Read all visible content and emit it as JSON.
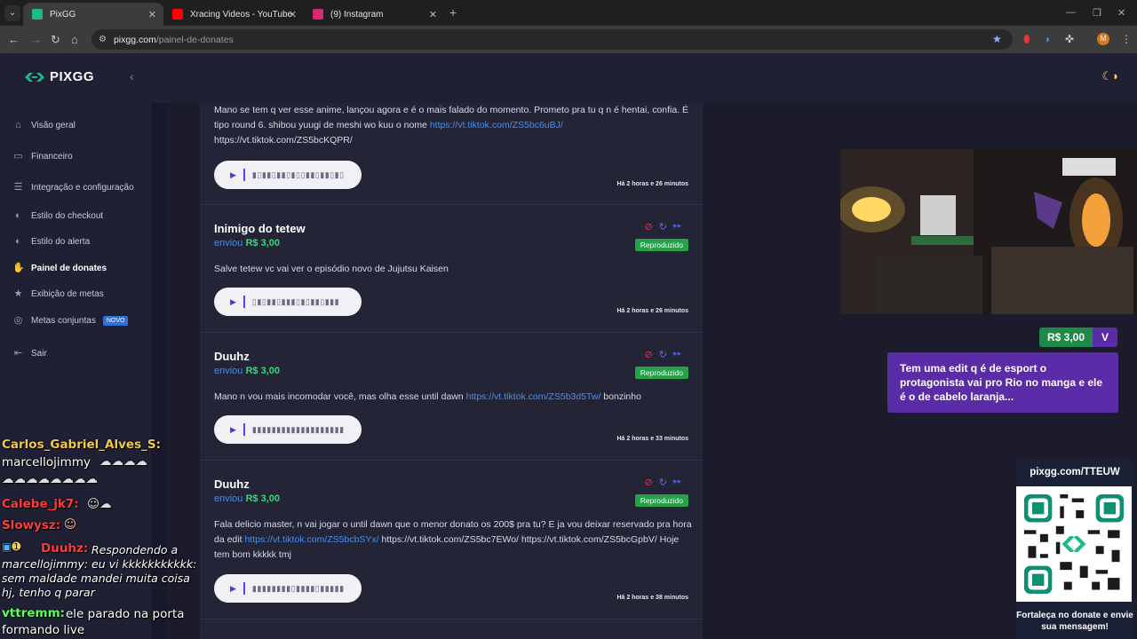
{
  "browser": {
    "tabs": [
      {
        "title": "PixGG",
        "active": true
      },
      {
        "title": "Xracing Videos - YouTube",
        "active": false
      },
      {
        "title": "(9) Instagram",
        "active": false
      }
    ],
    "new_tab": "+",
    "url_host": "pixgg.com",
    "url_path": "/painel-de-donates",
    "profile_initial": "M"
  },
  "sidebar": {
    "brand": "PIXGG",
    "items": [
      {
        "label": "Visão geral",
        "icon": "home-icon"
      },
      {
        "label": "Financeiro",
        "icon": "wallet-icon"
      },
      {
        "label": "Integração e configuração",
        "icon": "settings-icon"
      },
      {
        "label": "Estilo do checkout",
        "icon": "palette-icon"
      },
      {
        "label": "Estilo do alerta",
        "icon": "palette-icon"
      },
      {
        "label": "Painel de donates",
        "icon": "hand-coin-icon"
      },
      {
        "label": "Exibição de metas",
        "icon": "star-icon"
      },
      {
        "label": "Metas conjuntas",
        "icon": "target-icon",
        "badge": "NOVO"
      },
      {
        "label": "Sair",
        "icon": "logout-icon"
      }
    ]
  },
  "feed": {
    "sent_prefix": "enviou",
    "cards": [
      {
        "name": "",
        "amount": "",
        "message_parts": [
          {
            "text": "Mano se tem q ver esse anime, lançou agora e é o mais falado do momento. Prometo pra tu q n é hentai, confia. É tipo round 6. shibou yuugi de meshi wo kuu o nome "
          },
          {
            "text": "https://vt.tiktok.com/ZS5bc6uBJ/",
            "link": true
          },
          {
            "text": " https://vt.tiktok.com/ZS5bcKQPR/"
          }
        ],
        "waveform": "▮▯▮▮▯▮▮▯▮▯▯▮▮▯▮▮▯▮▯",
        "time": "Há 2 horas e 26 minutos"
      },
      {
        "name": "Inimigo do tetew",
        "amount": "R$ 3,00",
        "status": "Reproduzido",
        "message_parts": [
          {
            "text": "Salve tetew vc vai ver o episódio novo de Jujutsu Kaisen"
          }
        ],
        "waveform": "▯▮▯▮▮▯▮▮▮▯▮▯▮▮▯▮▮▮",
        "time": "Há 2 horas e 26 minutos"
      },
      {
        "name": "Duuhz",
        "amount": "R$ 3,00",
        "status": "Reproduzido",
        "message_parts": [
          {
            "text": "Mano n vou mais incomodar você, mas olha esse until dawn "
          },
          {
            "text": "https://vt.tiktok.com/ZS5b3d5Tw/",
            "link": true
          },
          {
            "text": " bonzinho"
          }
        ],
        "waveform": "▮▮▮▮▮▮▮▮▮▮▮▮▮▮▮▮▮▮▮",
        "time": "Há 2 horas e 33 minutos"
      },
      {
        "name": "Duuhz",
        "amount": "R$ 3,00",
        "status": "Reproduzido",
        "message_parts": [
          {
            "text": "Fala delicio master, n vai jogar o until dawn que o menor donato os 200$ pra tu? E ja vou deixar reservado pra hora da edit "
          },
          {
            "text": "https://vt.tiktok.com/ZS5bcbSYx/",
            "link": true
          },
          {
            "text": " https://vt.tiktok.com/ZS5bc7EWo/ https://vt.tiktok.com/ZS5bcGpbV/ Hoje tem bom kkkkk tmj"
          }
        ],
        "waveform": "▮▮▮▮▮▮▮▮▯▮▮▮▮▯▮▮▮▮▮",
        "time": "Há 2 horas e 38 minutos"
      }
    ]
  },
  "overlay": {
    "donation_amount": "R$ 3,00",
    "donation_user_initial": "V",
    "donation_message": "Tem uma edit q é de esport o protagonista vai pro Rio no manga e ele é o de cabelo laranja...",
    "qr_title": "pixgg.com/TTEUW",
    "qr_caption": "Fortaleça no donate e envie sua mensagem!"
  },
  "chat": [
    {
      "user": "Carlos_Gabriel_Alves_S:",
      "color": "#f2c94c"
    },
    {
      "text": "marcellojimmy"
    },
    {
      "user": "Calebe_jk7:",
      "color": "#ff3b3b"
    },
    {
      "user": "Slowysz:",
      "color": "#ff3b3b"
    },
    {
      "user": "Duuhz:",
      "color": "#ff3b3b",
      "text": "Respondendo a marcellojimmy: eu vi kkkkkkkkkkk: sem maldade mandei muita coisa hj, tenho q parar"
    },
    {
      "user": "vttremm:",
      "color": "#5cff5c",
      "text": "ele parado na porta formando live"
    }
  ],
  "colors": {
    "accent": "#4a8df0",
    "money": "#37d67a",
    "badge": "#27a24b",
    "overlay_purple": "#5b2ca8"
  }
}
